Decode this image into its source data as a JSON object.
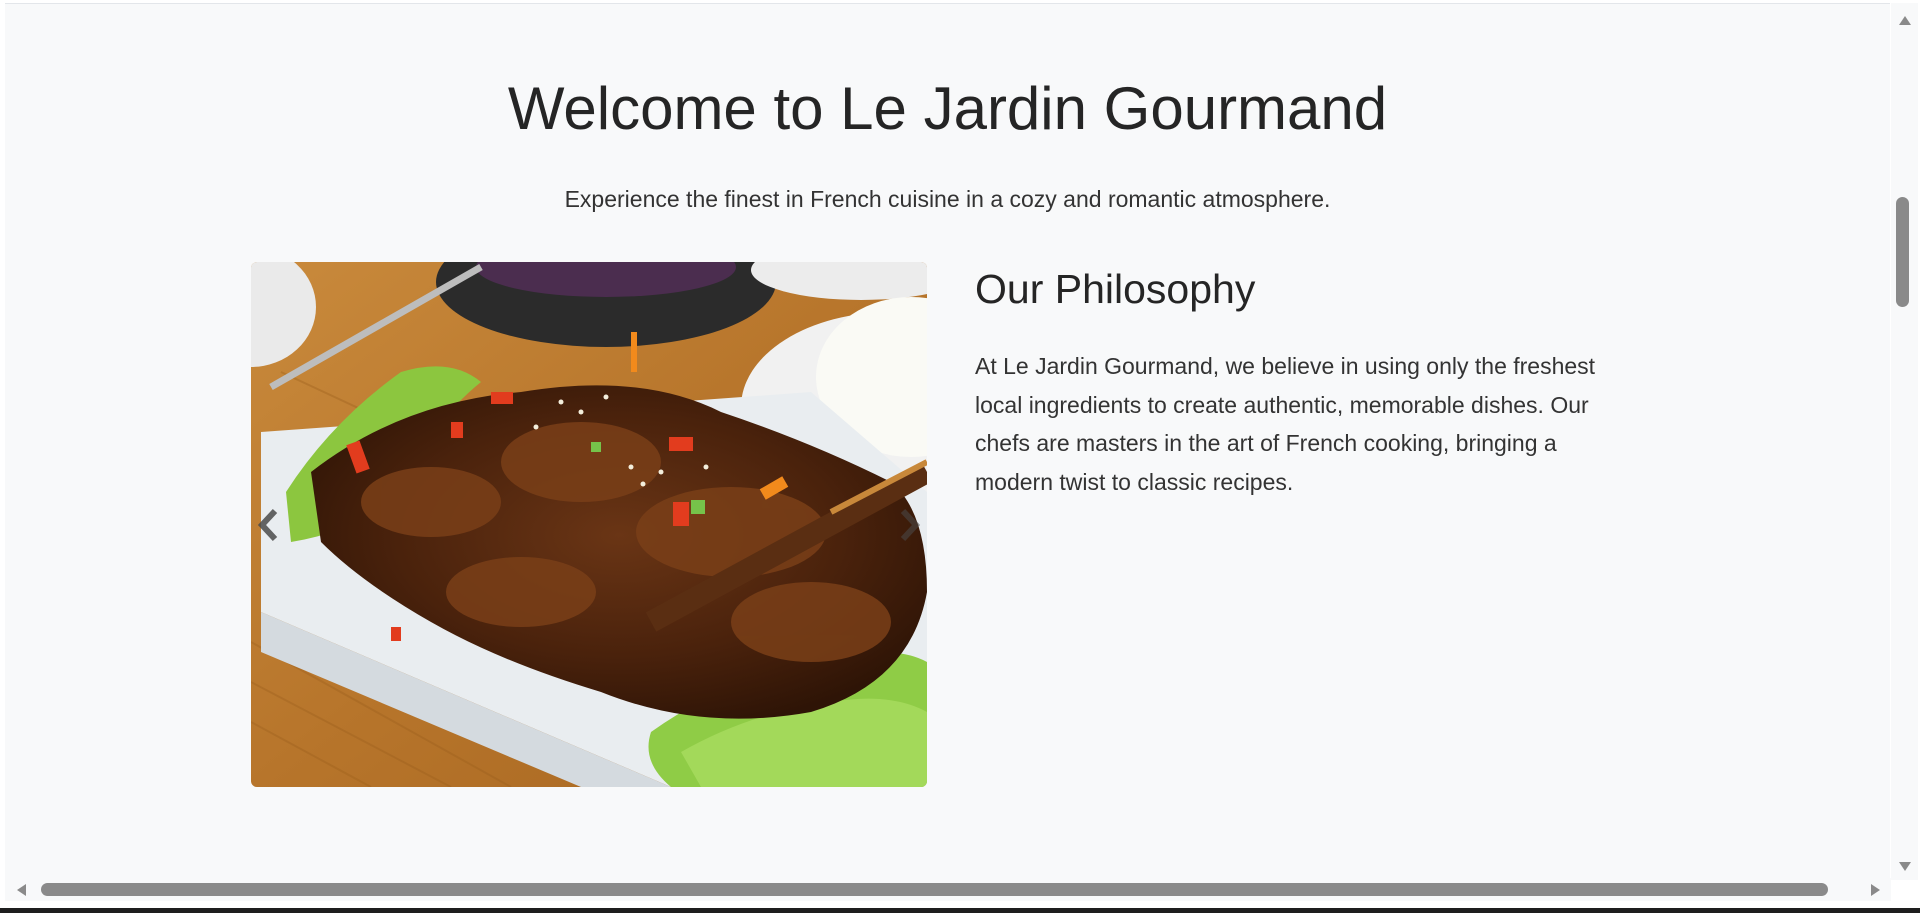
{
  "hero": {
    "title": "Welcome to Le Jardin Gourmand",
    "subtitle": "Experience the finest in French cuisine in a cozy and romantic atmosphere."
  },
  "carousel": {
    "image_alt": "Plate of glazed grilled ribs with lettuce and rice",
    "prev_icon": "chevron-left-icon",
    "next_icon": "chevron-right-icon"
  },
  "philosophy": {
    "title": "Our Philosophy",
    "text": "At Le Jardin Gourmand, we believe in using only the freshest local ingredients to create authentic, memorable dishes. Our chefs are masters in the art of French cooking, bringing a modern twist to classic recipes."
  },
  "colors": {
    "page_background": "#f8f9fa",
    "text": "#252525",
    "scrollbar_thumb": "#8a8a8a"
  }
}
